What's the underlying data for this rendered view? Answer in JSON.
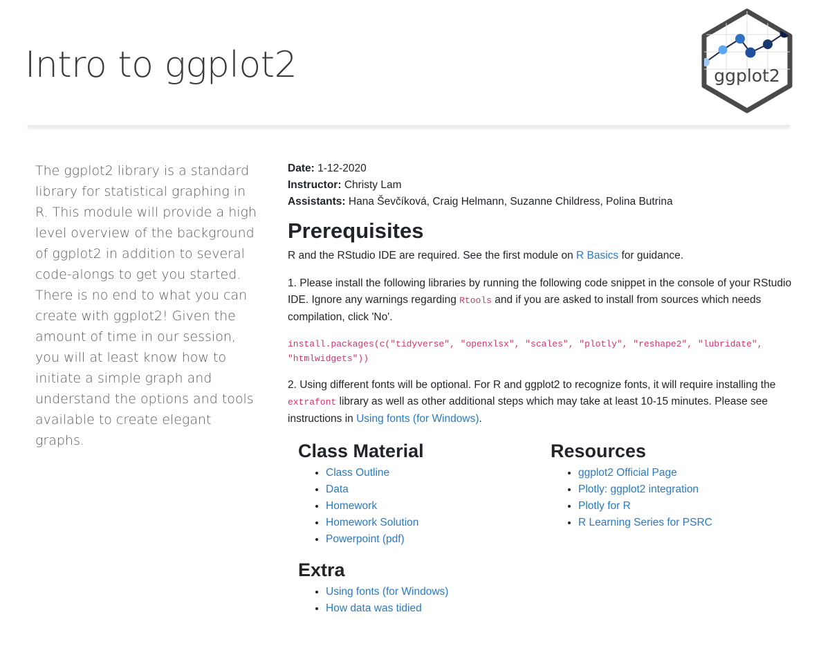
{
  "header": {
    "title": "Intro to ggplot2",
    "logo_text": "ggplot2"
  },
  "sidebar": {
    "description": "The ggplot2 library is a standard library for statistical graphing in R. This module will provide a high level overview of the background of ggplot2 in addition to several code-alongs to get you started. There is no end to what you can create with ggplot2! Given the amount of time in our session, you will at least know how to initiate a simple graph and understand the options and tools available to create elegant graphs."
  },
  "meta": {
    "date_label": "Date:",
    "date_value": "1-12-2020",
    "instructor_label": "Instructor:",
    "instructor_value": "Christy Lam",
    "assistants_label": "Assistants:",
    "assistants_value": "Hana Ševčíková, Craig Helmann, Suzanne Childress, Polina Butrina"
  },
  "prerequisites": {
    "heading": "Prerequisites",
    "intro_before": "R and the RStudio IDE are required. See the first module on ",
    "intro_link": "R Basics",
    "intro_after": " for guidance.",
    "step1_before": "1. Please install the following libraries by running the following code snippet in the console of your RStudio IDE. Ignore any warnings regarding ",
    "step1_code": "Rtools",
    "step1_after": " and if you are asked to install from sources which needs compilation, click 'No'.",
    "code_snippet": "install.packages(c(\"tidyverse\", \"openxlsx\", \"scales\", \"plotly\", \"reshape2\", \"lubridate\",\n\"htmlwidgets\"))",
    "step2_before": "2. Using different fonts will be optional. For R and ggplot2 to recognize fonts, it will require installing the ",
    "step2_code": "extrafont",
    "step2_middle": " library as well as other additional steps which may take at least 10-15 minutes. Please see instructions in ",
    "step2_link": "Using fonts (for Windows)",
    "step2_after": "."
  },
  "class_material": {
    "heading": "Class Material",
    "items": [
      "Class Outline",
      "Data",
      "Homework",
      "Homework Solution",
      "Powerpoint (pdf)"
    ]
  },
  "resources": {
    "heading": "Resources",
    "items": [
      "ggplot2 Official Page",
      "Plotly: ggplot2 integration",
      "Plotly for R",
      "R Learning Series for PSRC"
    ]
  },
  "extra": {
    "heading": "Extra",
    "items": [
      "Using fonts (for Windows)",
      "How data was tidied"
    ]
  },
  "colors": {
    "link": "#2a7ac2",
    "code": "#d6336c",
    "logo_border": "#4a4a4a"
  }
}
